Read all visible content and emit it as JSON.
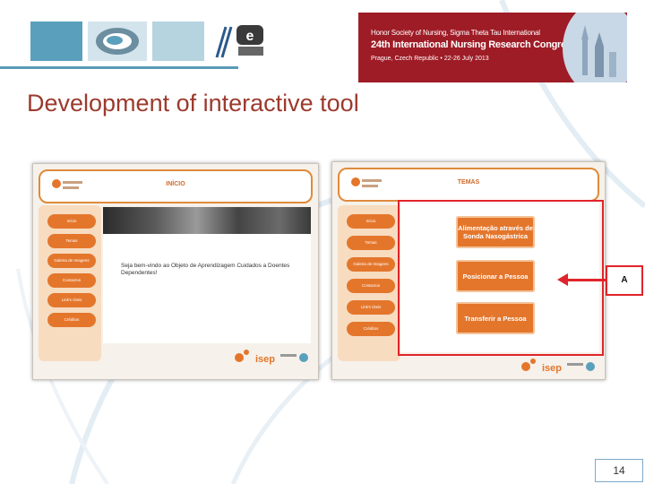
{
  "slide": {
    "title": "Development of  interactive tool",
    "page_number": "14"
  },
  "banner": {
    "line1": "Honor Society of Nursing, Sigma Theta Tau International",
    "line2": "24th International Nursing Research Congress",
    "line3": "Prague, Czech Republic • 22-26 July 2013"
  },
  "screen_left": {
    "header_title": "INÍCIO",
    "menu": [
      "Início",
      "Temas",
      "Galeria de Imagens",
      "Contactos",
      "Link's Úteis",
      "Créditos"
    ],
    "welcome_text": "Seja bem-vindo ao Objeto de Aprendizagem Cuidados a Doentes Dependentes!"
  },
  "screen_right": {
    "header_title": "TEMAS",
    "menu": [
      "Início",
      "Temas",
      "Galeria de Imagens",
      "Contactos",
      "Link's Úteis",
      "Créditos"
    ],
    "topics": [
      "Alimentação através de Sonda Nasogástrica",
      "Posicionar a Pessoa",
      "Transferir a Pessoa"
    ]
  },
  "callout": {
    "label": "A"
  },
  "colors": {
    "accent_orange": "#e4762c",
    "title_red": "#9c3a2e",
    "banner_red": "#9e1c26",
    "highlight_red": "#e0242b"
  },
  "icons": [
    "nursing-school-logo-icon",
    "e-learning-logo-icon",
    "isep-logo-icon",
    "arrow-left-icon"
  ]
}
